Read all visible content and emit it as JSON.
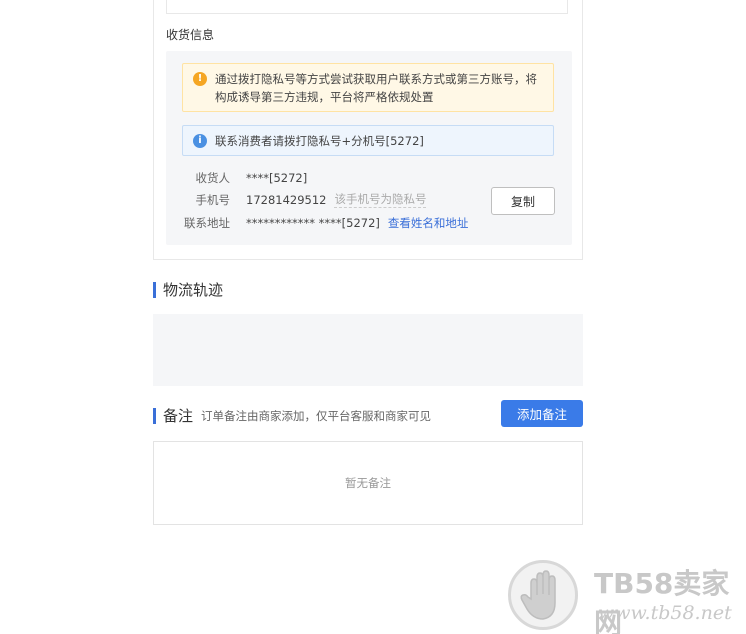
{
  "receiver": {
    "section_title": "收货信息",
    "warning_text": "通过拨打隐私号等方式尝试获取用户联系方式或第三方账号，将构成诱导第三方违规，平台将严格依规处置",
    "info_text": "联系消费者请拨打隐私号+分机号[5272]",
    "name_label": "收货人",
    "name_value": "****[5272]",
    "phone_label": "手机号",
    "phone_value": "17281429512",
    "phone_hint": "该手机号为隐私号",
    "address_label": "联系地址",
    "address_value": "************ ****[5272]",
    "view_link": "查看姓名和地址",
    "copy_label": "复制"
  },
  "logistics": {
    "title": "物流轨迹"
  },
  "notes": {
    "title": "备注",
    "subtitle": "订单备注由商家添加，仅平台客服和商家可见",
    "add_label": "添加备注",
    "empty_text": "暂无备注"
  },
  "watermark": {
    "brand": "TB58卖家网",
    "url": "www.tb58.net"
  },
  "colors": {
    "accent": "#3a7be8",
    "link": "#3a6fd8",
    "warning": "#f5a623",
    "info": "#4a90e2"
  }
}
